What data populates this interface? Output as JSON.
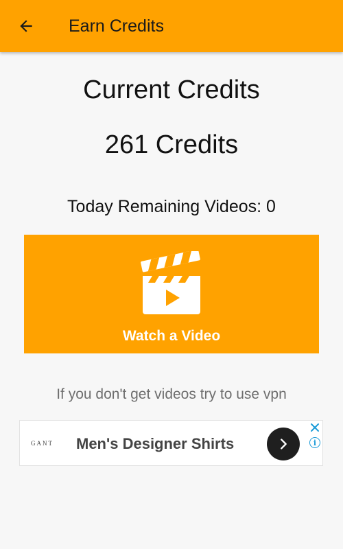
{
  "appbar": {
    "title": "Earn Credits",
    "back_icon": "arrow-left-icon",
    "color": "#ffa200"
  },
  "credits": {
    "label": "Current Credits",
    "value": "261 Credits"
  },
  "remaining": {
    "text": "Today Remaining Videos: 0"
  },
  "watch_button": {
    "label": "Watch a Video",
    "icon": "video-clapperboard-icon",
    "color": "#ffa200"
  },
  "hint": {
    "text": "If you don't get videos try to use vpn"
  },
  "ad": {
    "logo": "GANT",
    "title": "Men's Designer Shirts",
    "arrow_icon": "chevron-right-icon",
    "close_icon": "close-icon",
    "info_icon": "info-icon",
    "info_glyph": "i",
    "accent": "#1a9bd8"
  }
}
